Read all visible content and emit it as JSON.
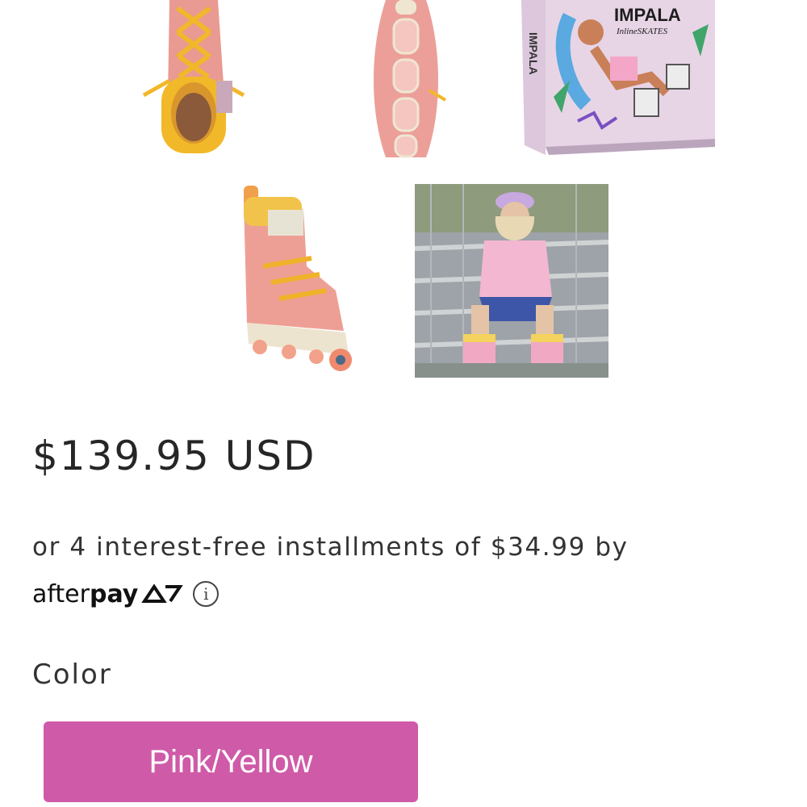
{
  "gallery": {
    "box_logo": "IMPALA",
    "box_sub": "InlineSKATES",
    "box_side": "IMPALA"
  },
  "product": {
    "price": "$139.95 USD",
    "installment_text": "or 4 interest-free installments of $34.99 by",
    "afterpay_light": "after",
    "afterpay_bold": "pay",
    "info_glyph": "i"
  },
  "variant": {
    "label": "Color",
    "selected": "Pink/Yellow",
    "button_color": "#cf5aa8"
  },
  "icons": [
    "afterpay-logo-icon",
    "info-icon"
  ]
}
